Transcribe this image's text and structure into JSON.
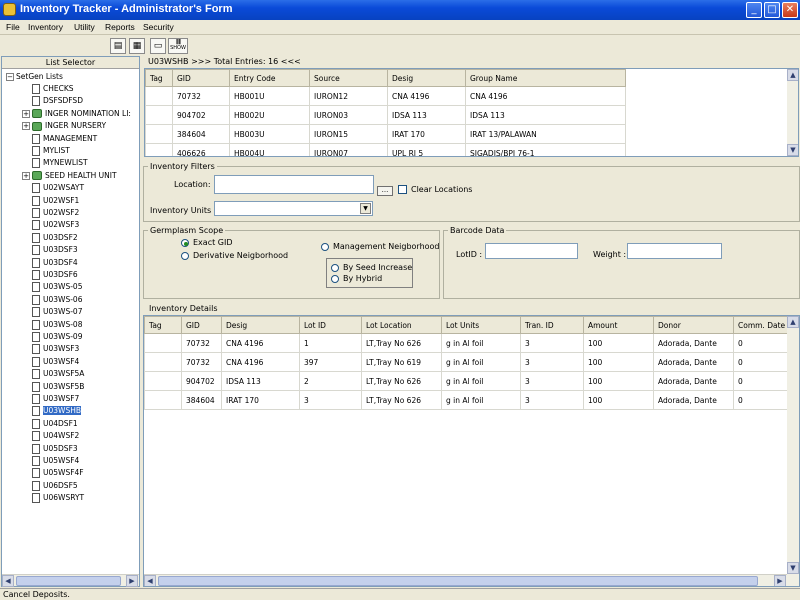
{
  "window": {
    "title": "Inventory Tracker - Administrator's Form"
  },
  "menu": [
    "File",
    "Inventory",
    "Utility",
    "Reports",
    "Security"
  ],
  "toolbar": {
    "barcode_label": "SHOW"
  },
  "left_panel": {
    "header": "List Selector",
    "root": "SetGen Lists",
    "items": [
      {
        "label": "CHECKS",
        "type": "doc"
      },
      {
        "label": "DSFSDFSD",
        "type": "doc"
      },
      {
        "label": "INGER NOMINATION LI:",
        "type": "db"
      },
      {
        "label": "INGER NURSERY",
        "type": "db"
      },
      {
        "label": "MANAGEMENT",
        "type": "doc"
      },
      {
        "label": "MYLIST",
        "type": "doc"
      },
      {
        "label": "MYNEWLIST",
        "type": "doc"
      },
      {
        "label": "SEED HEALTH UNIT",
        "type": "db"
      },
      {
        "label": "U02WSAYT",
        "type": "doc"
      },
      {
        "label": "U02WSF1",
        "type": "doc"
      },
      {
        "label": "U02WSF2",
        "type": "doc"
      },
      {
        "label": "U02WSF3",
        "type": "doc"
      },
      {
        "label": "U03DSF2",
        "type": "doc"
      },
      {
        "label": "U03DSF3",
        "type": "doc"
      },
      {
        "label": "U03DSF4",
        "type": "doc"
      },
      {
        "label": "U03DSF6",
        "type": "doc"
      },
      {
        "label": "U03WS-05",
        "type": "doc"
      },
      {
        "label": "U03WS-06",
        "type": "doc"
      },
      {
        "label": "U03WS-07",
        "type": "doc"
      },
      {
        "label": "U03WS-08",
        "type": "doc"
      },
      {
        "label": "U03WS-09",
        "type": "doc"
      },
      {
        "label": "U03WSF3",
        "type": "doc"
      },
      {
        "label": "U03WSF4",
        "type": "doc"
      },
      {
        "label": "U03WSF5A",
        "type": "doc"
      },
      {
        "label": "U03WSF5B",
        "type": "doc"
      },
      {
        "label": "U03WSF7",
        "type": "doc"
      },
      {
        "label": "U03WSHB",
        "type": "doc",
        "selected": true
      },
      {
        "label": "U04DSF1",
        "type": "doc"
      },
      {
        "label": "U04WSF2",
        "type": "doc"
      },
      {
        "label": "U05DSF3",
        "type": "doc"
      },
      {
        "label": "U05WSF4",
        "type": "doc"
      },
      {
        "label": "U05WSF4F",
        "type": "doc"
      },
      {
        "label": "U06DSF5",
        "type": "doc"
      },
      {
        "label": "U06WSRYT",
        "type": "doc"
      }
    ]
  },
  "entries": {
    "header": "U03WSHB >>> Total Entries: 16 <<<",
    "columns": [
      "Tag",
      "GID",
      "Entry Code",
      "Source",
      "Desig",
      "Group Name"
    ],
    "rows": [
      [
        "",
        "70732",
        "HB001U",
        "IURON12",
        "CNA 4196",
        "CNA 4196"
      ],
      [
        "",
        "904702",
        "HB002U",
        "IURON03",
        "IDSA 113",
        "IDSA 113"
      ],
      [
        "",
        "384604",
        "HB003U",
        "IURON15",
        "IRAT 170",
        "IRAT 13/PALAWAN"
      ],
      [
        "",
        "406626",
        "HB004U",
        "IURON07",
        "UPL RI 5",
        "SIGADIS/BPI 76-1"
      ]
    ]
  },
  "filters": {
    "legend": "Inventory Filters",
    "location_label": "Location:",
    "browse_label": "...",
    "clear_locations_label": "Clear Locations",
    "units_label": "Inventory Units :"
  },
  "scope": {
    "legend": "Germplasm Scope",
    "exact_gid": "Exact GID",
    "derivative": "Derivative Neigborhood",
    "management": "Management Neigborhood",
    "by_seed_increase": "By Seed Increase",
    "by_hybrid": "By Hybrid"
  },
  "barcode": {
    "legend": "Barcode Data",
    "lotid_label": "LotID :",
    "weight_label": "Weight :"
  },
  "details": {
    "legend": "Inventory Details",
    "columns": [
      "Tag",
      "GID",
      "Desig",
      "Lot ID",
      "Lot Location",
      "Lot Units",
      "Tran. ID",
      "Amount",
      "Donor",
      "Comm. Date"
    ],
    "rows": [
      [
        "",
        "70732",
        "CNA 4196",
        "1",
        "LT,Tray No 626",
        "g in Al foil",
        "3",
        "100",
        "Adorada, Dante",
        "0"
      ],
      [
        "",
        "70732",
        "CNA 4196",
        "397",
        "LT,Tray No 619",
        "g in Al foil",
        "3",
        "100",
        "Adorada, Dante",
        "0"
      ],
      [
        "",
        "904702",
        "IDSA 113",
        "2",
        "LT,Tray No 626",
        "g in Al foil",
        "3",
        "100",
        "Adorada, Dante",
        "0"
      ],
      [
        "",
        "384604",
        "IRAT 170",
        "3",
        "LT,Tray No 626",
        "g in Al foil",
        "3",
        "100",
        "Adorada, Dante",
        "0"
      ]
    ]
  },
  "status": {
    "text": "Cancel Deposits."
  }
}
